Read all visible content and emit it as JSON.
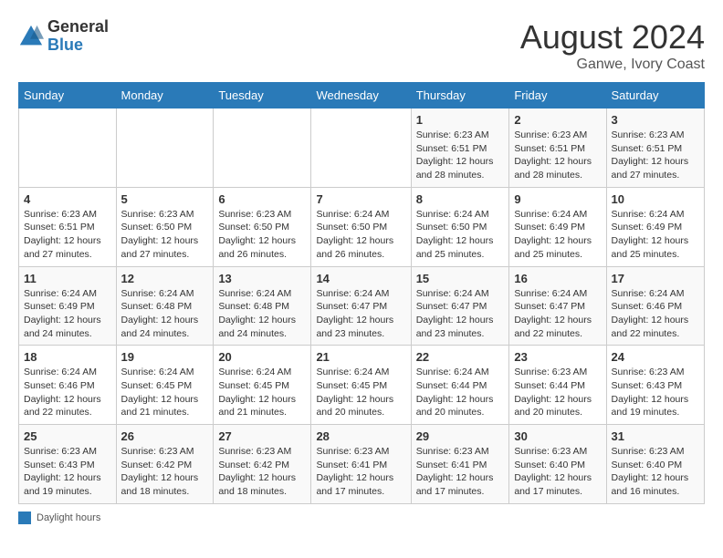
{
  "header": {
    "logo_general": "General",
    "logo_blue": "Blue",
    "title": "August 2024",
    "subtitle": "Ganwe, Ivory Coast"
  },
  "columns": [
    "Sunday",
    "Monday",
    "Tuesday",
    "Wednesday",
    "Thursday",
    "Friday",
    "Saturday"
  ],
  "weeks": [
    [
      {
        "day": "",
        "info": ""
      },
      {
        "day": "",
        "info": ""
      },
      {
        "day": "",
        "info": ""
      },
      {
        "day": "",
        "info": ""
      },
      {
        "day": "1",
        "info": "Sunrise: 6:23 AM\nSunset: 6:51 PM\nDaylight: 12 hours\nand 28 minutes."
      },
      {
        "day": "2",
        "info": "Sunrise: 6:23 AM\nSunset: 6:51 PM\nDaylight: 12 hours\nand 28 minutes."
      },
      {
        "day": "3",
        "info": "Sunrise: 6:23 AM\nSunset: 6:51 PM\nDaylight: 12 hours\nand 27 minutes."
      }
    ],
    [
      {
        "day": "4",
        "info": "Sunrise: 6:23 AM\nSunset: 6:51 PM\nDaylight: 12 hours\nand 27 minutes."
      },
      {
        "day": "5",
        "info": "Sunrise: 6:23 AM\nSunset: 6:50 PM\nDaylight: 12 hours\nand 27 minutes."
      },
      {
        "day": "6",
        "info": "Sunrise: 6:23 AM\nSunset: 6:50 PM\nDaylight: 12 hours\nand 26 minutes."
      },
      {
        "day": "7",
        "info": "Sunrise: 6:24 AM\nSunset: 6:50 PM\nDaylight: 12 hours\nand 26 minutes."
      },
      {
        "day": "8",
        "info": "Sunrise: 6:24 AM\nSunset: 6:50 PM\nDaylight: 12 hours\nand 25 minutes."
      },
      {
        "day": "9",
        "info": "Sunrise: 6:24 AM\nSunset: 6:49 PM\nDaylight: 12 hours\nand 25 minutes."
      },
      {
        "day": "10",
        "info": "Sunrise: 6:24 AM\nSunset: 6:49 PM\nDaylight: 12 hours\nand 25 minutes."
      }
    ],
    [
      {
        "day": "11",
        "info": "Sunrise: 6:24 AM\nSunset: 6:49 PM\nDaylight: 12 hours\nand 24 minutes."
      },
      {
        "day": "12",
        "info": "Sunrise: 6:24 AM\nSunset: 6:48 PM\nDaylight: 12 hours\nand 24 minutes."
      },
      {
        "day": "13",
        "info": "Sunrise: 6:24 AM\nSunset: 6:48 PM\nDaylight: 12 hours\nand 24 minutes."
      },
      {
        "day": "14",
        "info": "Sunrise: 6:24 AM\nSunset: 6:47 PM\nDaylight: 12 hours\nand 23 minutes."
      },
      {
        "day": "15",
        "info": "Sunrise: 6:24 AM\nSunset: 6:47 PM\nDaylight: 12 hours\nand 23 minutes."
      },
      {
        "day": "16",
        "info": "Sunrise: 6:24 AM\nSunset: 6:47 PM\nDaylight: 12 hours\nand 22 minutes."
      },
      {
        "day": "17",
        "info": "Sunrise: 6:24 AM\nSunset: 6:46 PM\nDaylight: 12 hours\nand 22 minutes."
      }
    ],
    [
      {
        "day": "18",
        "info": "Sunrise: 6:24 AM\nSunset: 6:46 PM\nDaylight: 12 hours\nand 22 minutes."
      },
      {
        "day": "19",
        "info": "Sunrise: 6:24 AM\nSunset: 6:45 PM\nDaylight: 12 hours\nand 21 minutes."
      },
      {
        "day": "20",
        "info": "Sunrise: 6:24 AM\nSunset: 6:45 PM\nDaylight: 12 hours\nand 21 minutes."
      },
      {
        "day": "21",
        "info": "Sunrise: 6:24 AM\nSunset: 6:45 PM\nDaylight: 12 hours\nand 20 minutes."
      },
      {
        "day": "22",
        "info": "Sunrise: 6:24 AM\nSunset: 6:44 PM\nDaylight: 12 hours\nand 20 minutes."
      },
      {
        "day": "23",
        "info": "Sunrise: 6:23 AM\nSunset: 6:44 PM\nDaylight: 12 hours\nand 20 minutes."
      },
      {
        "day": "24",
        "info": "Sunrise: 6:23 AM\nSunset: 6:43 PM\nDaylight: 12 hours\nand 19 minutes."
      }
    ],
    [
      {
        "day": "25",
        "info": "Sunrise: 6:23 AM\nSunset: 6:43 PM\nDaylight: 12 hours\nand 19 minutes."
      },
      {
        "day": "26",
        "info": "Sunrise: 6:23 AM\nSunset: 6:42 PM\nDaylight: 12 hours\nand 18 minutes."
      },
      {
        "day": "27",
        "info": "Sunrise: 6:23 AM\nSunset: 6:42 PM\nDaylight: 12 hours\nand 18 minutes."
      },
      {
        "day": "28",
        "info": "Sunrise: 6:23 AM\nSunset: 6:41 PM\nDaylight: 12 hours\nand 17 minutes."
      },
      {
        "day": "29",
        "info": "Sunrise: 6:23 AM\nSunset: 6:41 PM\nDaylight: 12 hours\nand 17 minutes."
      },
      {
        "day": "30",
        "info": "Sunrise: 6:23 AM\nSunset: 6:40 PM\nDaylight: 12 hours\nand 17 minutes."
      },
      {
        "day": "31",
        "info": "Sunrise: 6:23 AM\nSunset: 6:40 PM\nDaylight: 12 hours\nand 16 minutes."
      }
    ]
  ],
  "legend": {
    "box_color": "#2a7ab8",
    "label": "Daylight hours"
  }
}
